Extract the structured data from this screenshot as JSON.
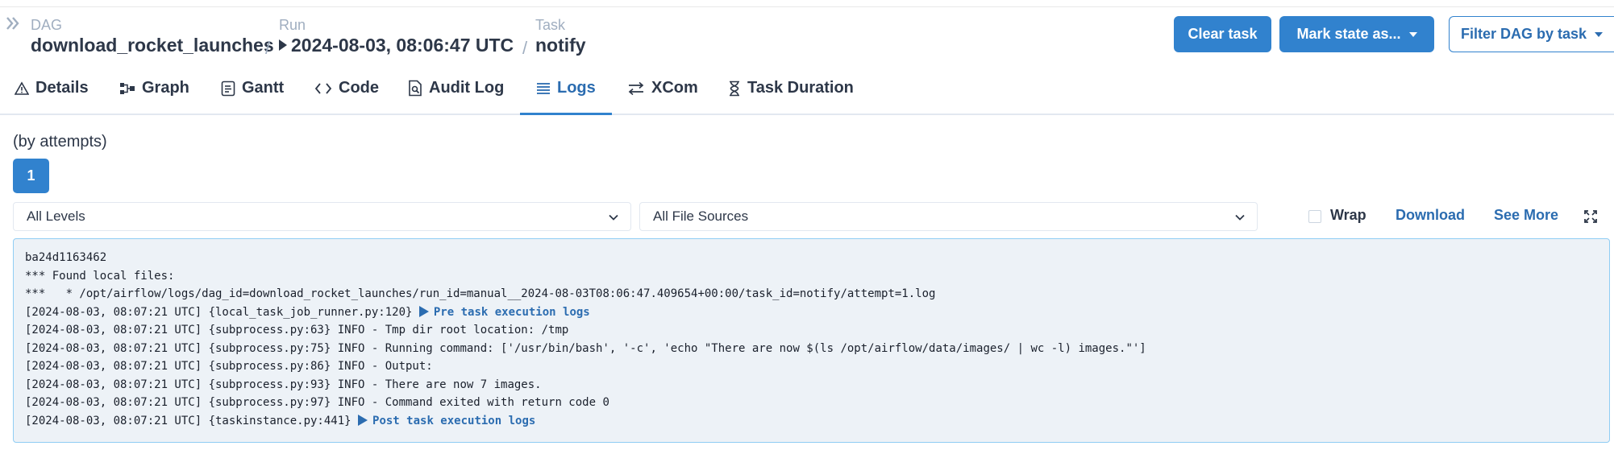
{
  "breadcrumb": {
    "dag_label": "DAG",
    "dag_value": "download_rocket_launches",
    "run_label": "Run",
    "run_value": "2024-08-03, 08:06:47 UTC",
    "task_label": "Task",
    "task_value": "notify",
    "separator": "/"
  },
  "header_actions": {
    "clear_task": "Clear task",
    "mark_state": "Mark state as...",
    "filter_dag": "Filter DAG by task"
  },
  "tabs": [
    {
      "label": "Details",
      "icon": "warning-triangle-icon"
    },
    {
      "label": "Graph",
      "icon": "graph-icon"
    },
    {
      "label": "Gantt",
      "icon": "gantt-icon"
    },
    {
      "label": "Code",
      "icon": "code-icon"
    },
    {
      "label": "Audit Log",
      "icon": "audit-log-icon"
    },
    {
      "label": "Logs",
      "icon": "logs-icon",
      "active": true
    },
    {
      "label": "XCom",
      "icon": "xcom-arrows-icon"
    },
    {
      "label": "Task Duration",
      "icon": "hourglass-icon"
    }
  ],
  "attempts": {
    "label": "(by attempts)",
    "items": [
      "1"
    ],
    "selected": "1"
  },
  "filters": {
    "levels": "All Levels",
    "file_sources": "All File Sources",
    "wrap_label": "Wrap",
    "wrap_checked": false,
    "download_label": "Download",
    "see_more_label": "See More"
  },
  "log": {
    "lines": [
      "ba24d1163462",
      "*** Found local files:",
      "***   * /opt/airflow/logs/dag_id=download_rocket_launches/run_id=manual__2024-08-03T08:06:47.409654+00:00/task_id=notify/attempt=1.log"
    ],
    "pre_task_prefix": "[2024-08-03, 08:07:21 UTC] {local_task_job_runner.py:120} ",
    "pre_task_link": "Pre task execution logs",
    "body_lines": [
      "[2024-08-03, 08:07:21 UTC] {subprocess.py:63} INFO - Tmp dir root location: /tmp",
      "[2024-08-03, 08:07:21 UTC] {subprocess.py:75} INFO - Running command: ['/usr/bin/bash', '-c', 'echo \"There are now $(ls /opt/airflow/data/images/ | wc -l) images.\"']",
      "[2024-08-03, 08:07:21 UTC] {subprocess.py:86} INFO - Output:",
      "[2024-08-03, 08:07:21 UTC] {subprocess.py:93} INFO - There are now 7 images.",
      "[2024-08-03, 08:07:21 UTC] {subprocess.py:97} INFO - Command exited with return code 0"
    ],
    "post_task_prefix": "[2024-08-03, 08:07:21 UTC] {taskinstance.py:441} ",
    "post_task_link": "Post task execution logs"
  },
  "colors": {
    "accent": "#3182ce",
    "link": "#2b6cb0",
    "log_background": "#edf2f7",
    "log_border": "#90cdf4"
  }
}
